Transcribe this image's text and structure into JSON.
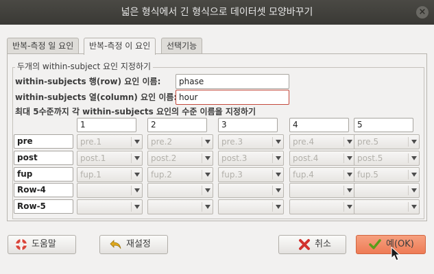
{
  "window": {
    "title": "넓은 형식에서 긴 형식으로 데이터셋 모양바꾸기"
  },
  "tabs": [
    {
      "label": "반복-측정 일 요인",
      "active": false
    },
    {
      "label": "반복-측정 이 요인",
      "active": true
    },
    {
      "label": "선택기능",
      "active": false
    }
  ],
  "group": {
    "title": "두개의 within-subject 요인 지정하기",
    "row_factor_label": "within-subjects 행(row) 요인 이름:",
    "row_factor_value": "phase",
    "col_factor_label": "within-subjects 열(column) 요인 이름:",
    "col_factor_value": "hour",
    "levels_label": "최대 5수준까지 각 within-subjects 요인의 수준 이름을 지정하기"
  },
  "columns": [
    "1",
    "2",
    "3",
    "4",
    "5"
  ],
  "rows": [
    {
      "name": "pre",
      "cells": [
        "pre.1",
        "pre.2",
        "pre.3",
        "pre.4",
        "pre.5"
      ]
    },
    {
      "name": "post",
      "cells": [
        "post.1",
        "post.2",
        "post.3",
        "post.4",
        "post.5"
      ]
    },
    {
      "name": "fup",
      "cells": [
        "fup.1",
        "fup.2",
        "fup.3",
        "fup.4",
        "fup.5"
      ]
    },
    {
      "name": "Row-4",
      "cells": [
        "",
        "",
        "",
        "",
        ""
      ]
    },
    {
      "name": "Row-5",
      "cells": [
        "",
        "",
        "",
        "",
        ""
      ]
    }
  ],
  "buttons": {
    "help": "도움말",
    "reset": "재설정",
    "cancel": "취소",
    "ok": "예(OK)"
  },
  "colors": {
    "ok_button": "#ee7b55",
    "titlebar": "#3c3b37"
  }
}
